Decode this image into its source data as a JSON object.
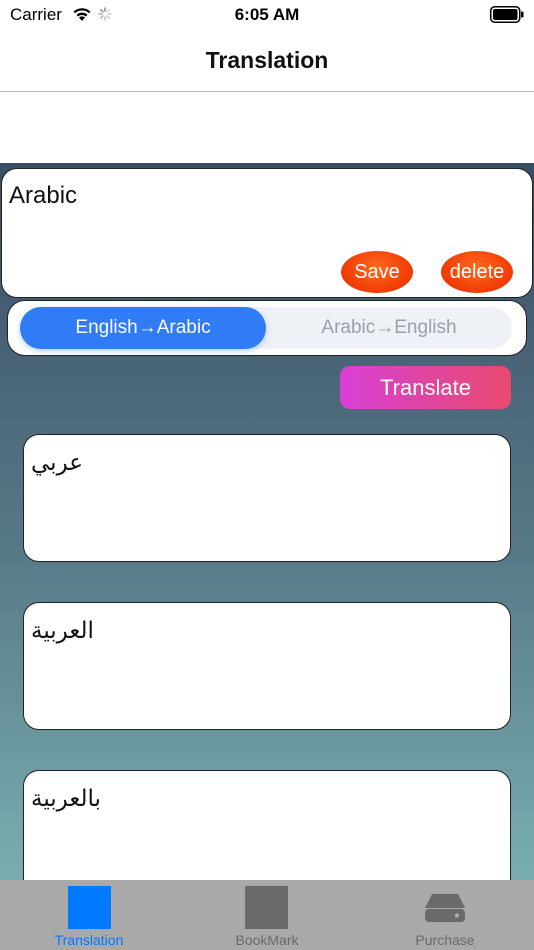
{
  "status_bar": {
    "carrier": "Carrier",
    "time": "6:05 AM"
  },
  "nav": {
    "title": "Translation"
  },
  "input": {
    "value": "Arabic",
    "save_label": "Save",
    "delete_label": "delete"
  },
  "direction": {
    "options": [
      "English→Arabic",
      "Arabic→English"
    ],
    "selected": "English→Arabic"
  },
  "translate_label": "Translate",
  "results": [
    "عربي",
    "العربية",
    "بالعربية"
  ],
  "tabs": [
    {
      "label": "Translation",
      "icon": "square-icon",
      "active": true
    },
    {
      "label": "BookMark",
      "icon": "square-icon",
      "active": false
    },
    {
      "label": "Purchase",
      "icon": "drive-icon",
      "active": false
    }
  ],
  "colors": {
    "accent": "#007aff",
    "segment_active": "#2f7cf6",
    "button_orange": "#f03a05",
    "translate_start": "#d840d6",
    "translate_end": "#e84a6e"
  }
}
